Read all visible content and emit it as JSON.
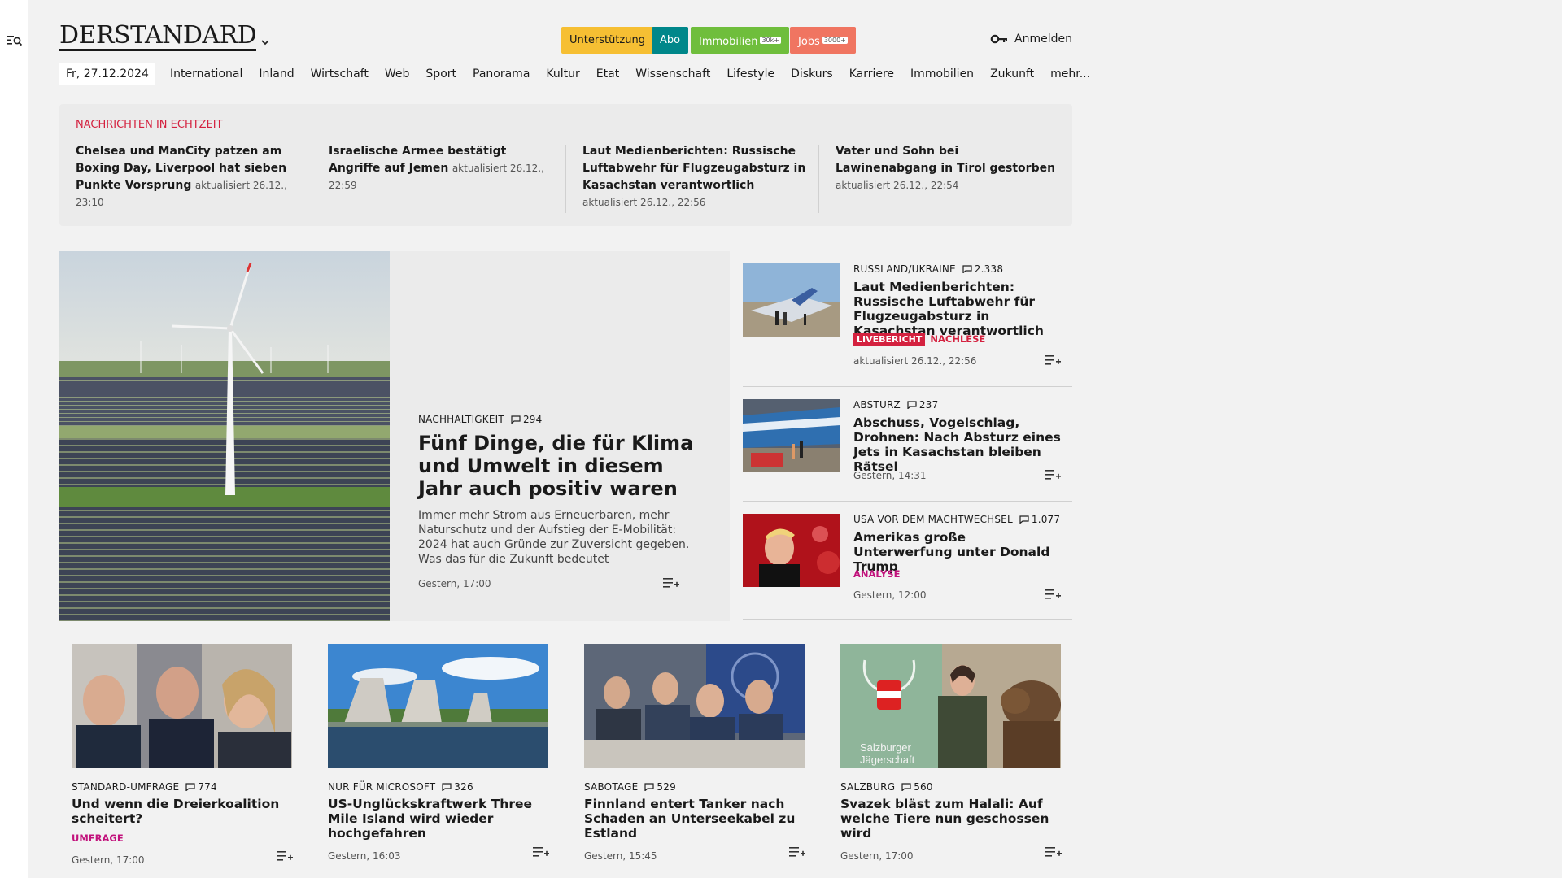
{
  "header": {
    "logo": "DERSTANDARD",
    "support": "Unterstützung",
    "abo": "Abo",
    "immobilien": "Immobilien",
    "immobilien_badge": "30k+",
    "jobs": "Jobs",
    "jobs_badge": "3000+",
    "login": "Anmelden"
  },
  "nav": {
    "date": "Fr, 27.12.2024",
    "items": [
      "International",
      "Inland",
      "Wirtschaft",
      "Web",
      "Sport",
      "Panorama",
      "Kultur",
      "Etat",
      "Wissenschaft",
      "Lifestyle",
      "Diskurs",
      "Karriere",
      "Immobilien",
      "Zukunft",
      "mehr..."
    ]
  },
  "ticker": {
    "title": "NACHRICHTEN IN ECHTZEIT",
    "items": [
      {
        "title": "Chelsea und ManCity patzen am Boxing Day, Liverpool hat sieben Punkte Vorsprung",
        "time": "aktualisiert 26.12., 23:10"
      },
      {
        "title": "Israelische Armee bestätigt Angriffe auf Jemen",
        "time": "aktualisiert 26.12., 22:59"
      },
      {
        "title": "Laut Medienberichten: Russische Luftabwehr für Flugzeugabsturz in Kasachstan verantwortlich",
        "time": "aktualisiert 26.12., 22:56"
      },
      {
        "title": "Vater und Sohn bei Lawinenabgang in Tirol gestorben",
        "time": "aktualisiert 26.12., 22:54"
      }
    ]
  },
  "hero": {
    "kicker": "NACHHALTIGKEIT",
    "comments": "294",
    "title": "Fünf Dinge, die für Klima und Umwelt in diesem Jahr auch positiv waren",
    "lede": "Immer mehr Strom aus Erneuerbaren, mehr Naturschutz und der Aufstieg der E-Mobilität: 2024 hat auch Gründe zur Zuversicht gegeben. Was das für die Zukunft bedeutet",
    "time": "Gestern, 17:00"
  },
  "side": [
    {
      "kicker": "RUSSLAND/UKRAINE",
      "comments": "2.338",
      "title": "Laut Medienberichten: Russische Luftabwehr für Flugzeugabsturz in Kasachstan verantwortlich",
      "badge_live": "LIVEBERICHT",
      "badge_extra": "NACHLESE",
      "time": "aktualisiert 26.12., 22:56"
    },
    {
      "kicker": "ABSTURZ",
      "comments": "237",
      "title": "Abschuss, Vogelschlag, Drohnen: Nach Absturz eines Jets in Kasachstan bleiben Rätsel",
      "time": "Gestern, 14:31"
    },
    {
      "kicker": "USA VOR DEM MACHTWECHSEL",
      "comments": "1.077",
      "title": "Amerikas große Unterwerfung unter Donald Trump",
      "badge": "ANALYSE",
      "time": "Gestern, 12:00"
    }
  ],
  "cards": [
    {
      "kicker": "STANDARD-UMFRAGE",
      "comments": "774",
      "title": "Und wenn die Dreierkoalition scheitert?",
      "badge": "UMFRAGE",
      "time": "Gestern, 17:00"
    },
    {
      "kicker": "NUR FÜR MICROSOFT",
      "comments": "326",
      "title": "US-Unglückskraftwerk Three Mile Island wird wieder hochgefahren",
      "time": "Gestern, 16:03"
    },
    {
      "kicker": "SABOTAGE",
      "comments": "529",
      "title": "Finnland entert Tanker nach Schaden an Unterseekabel zu Estland",
      "time": "Gestern, 15:45"
    },
    {
      "kicker": "SALZBURG",
      "comments": "560",
      "title": "Svazek bläst zum Halali: Auf welche Tiere nun geschossen wird",
      "time": "Gestern, 17:00",
      "image_text": "Salzburger Jägerschaft"
    }
  ]
}
